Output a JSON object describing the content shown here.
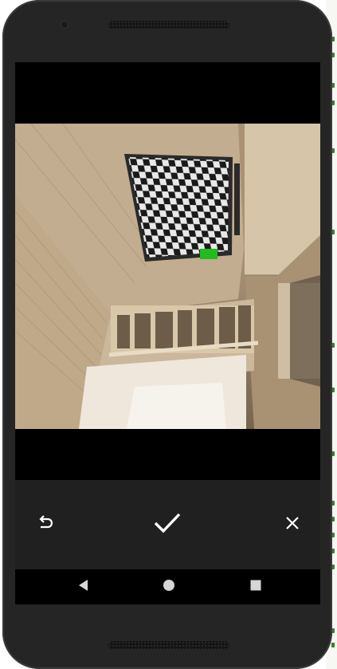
{
  "screen": "camera-capture-review",
  "colors": {
    "phone_body": "#252525",
    "screen_bg": "#000000",
    "controls_bg": "#202020",
    "icon": "#ffffff",
    "checker_dark": "#1a1a1a",
    "checker_light": "#e8e8e8",
    "marker": "#22bb22"
  },
  "controls": {
    "retake": {
      "icon": "undo-arrow-icon"
    },
    "confirm": {
      "icon": "checkmark-icon"
    },
    "cancel": {
      "icon": "close-icon"
    }
  },
  "navigation": {
    "back": {
      "icon": "back-triangle-icon"
    },
    "home": {
      "icon": "home-circle-icon"
    },
    "recents": {
      "icon": "recents-square-icon"
    }
  },
  "photo": {
    "subject": "checkerboard-pattern"
  }
}
